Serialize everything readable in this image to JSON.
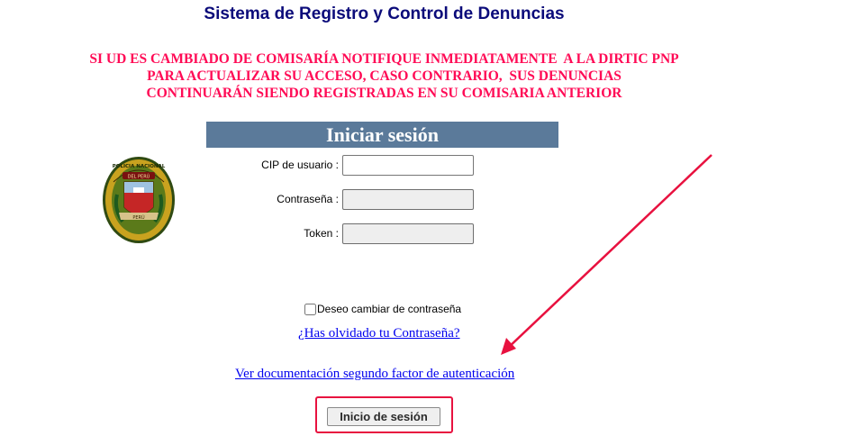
{
  "page": {
    "title": "Sistema de Registro y Control de Denuncias",
    "notice_lines": [
      "SI UD ES CAMBIADO DE COMISARÍA NOTIFIQUE INMEDIATAMENTE  A LA DIRTIC PNP",
      "PARA ACTUALIZAR SU ACCESO, CASO CONTRARIO,  SUS DENUNCIAS",
      "CONTINUARÁN SIENDO REGISTRADAS EN SU COMISARIA ANTERIOR"
    ]
  },
  "login": {
    "header": "Iniciar sesión",
    "cip_label": "CIP de usuario :",
    "cip_value": "",
    "password_label": "Contraseña :",
    "password_value": "",
    "token_label": "Token :",
    "token_value": "",
    "change_password_label": "Deseo cambiar de contraseña",
    "change_password_checked": false,
    "forgot_link": "¿Has olvidado tu Contraseña?",
    "docs_link": "Ver documentación segundo factor de autenticación",
    "submit_label": "Inicio de sesión"
  },
  "emblem": {
    "top_text": "POLICIA NACIONAL",
    "band_text": "DEL PERÚ",
    "bottom_text": "PERÚ"
  },
  "annotation": {
    "arrow_color": "#e8113f",
    "highlight_color": "#e8113f"
  },
  "colors": {
    "title": "#0b0b7a",
    "notice": "#ff0a55",
    "header_bg": "#5b7a9a",
    "link": "#0000ee"
  }
}
